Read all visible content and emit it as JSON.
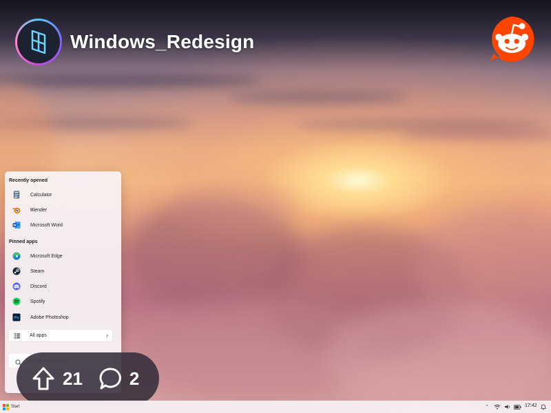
{
  "subreddit": {
    "name": "Windows_Redesign",
    "logo_icon": "subreddit-logo-icon",
    "reddit_icon": "reddit-snoo-icon",
    "reddit_color": "#ff4500"
  },
  "start_menu": {
    "recent_title": "Recently opened",
    "recent": [
      {
        "label": "Calculator",
        "icon": "calculator-icon"
      },
      {
        "label": "Blender",
        "icon": "blender-icon"
      },
      {
        "label": "Microsoft Word",
        "icon": "word-icon"
      }
    ],
    "pinned_title": "Pinned apps",
    "pinned": [
      {
        "label": "Microsoft Edge",
        "icon": "edge-icon"
      },
      {
        "label": "Steam",
        "icon": "steam-icon"
      },
      {
        "label": "Discord",
        "icon": "discord-icon"
      },
      {
        "label": "Spotify",
        "icon": "spotify-icon"
      },
      {
        "label": "Adobe Photoshop",
        "icon": "photoshop-icon"
      }
    ],
    "all_apps_label": "All apps",
    "search_placeholder": "Search everything"
  },
  "post_stats": {
    "upvotes": "21",
    "comments": "2"
  },
  "taskbar": {
    "start_label": "Start",
    "clock": "17:42"
  }
}
